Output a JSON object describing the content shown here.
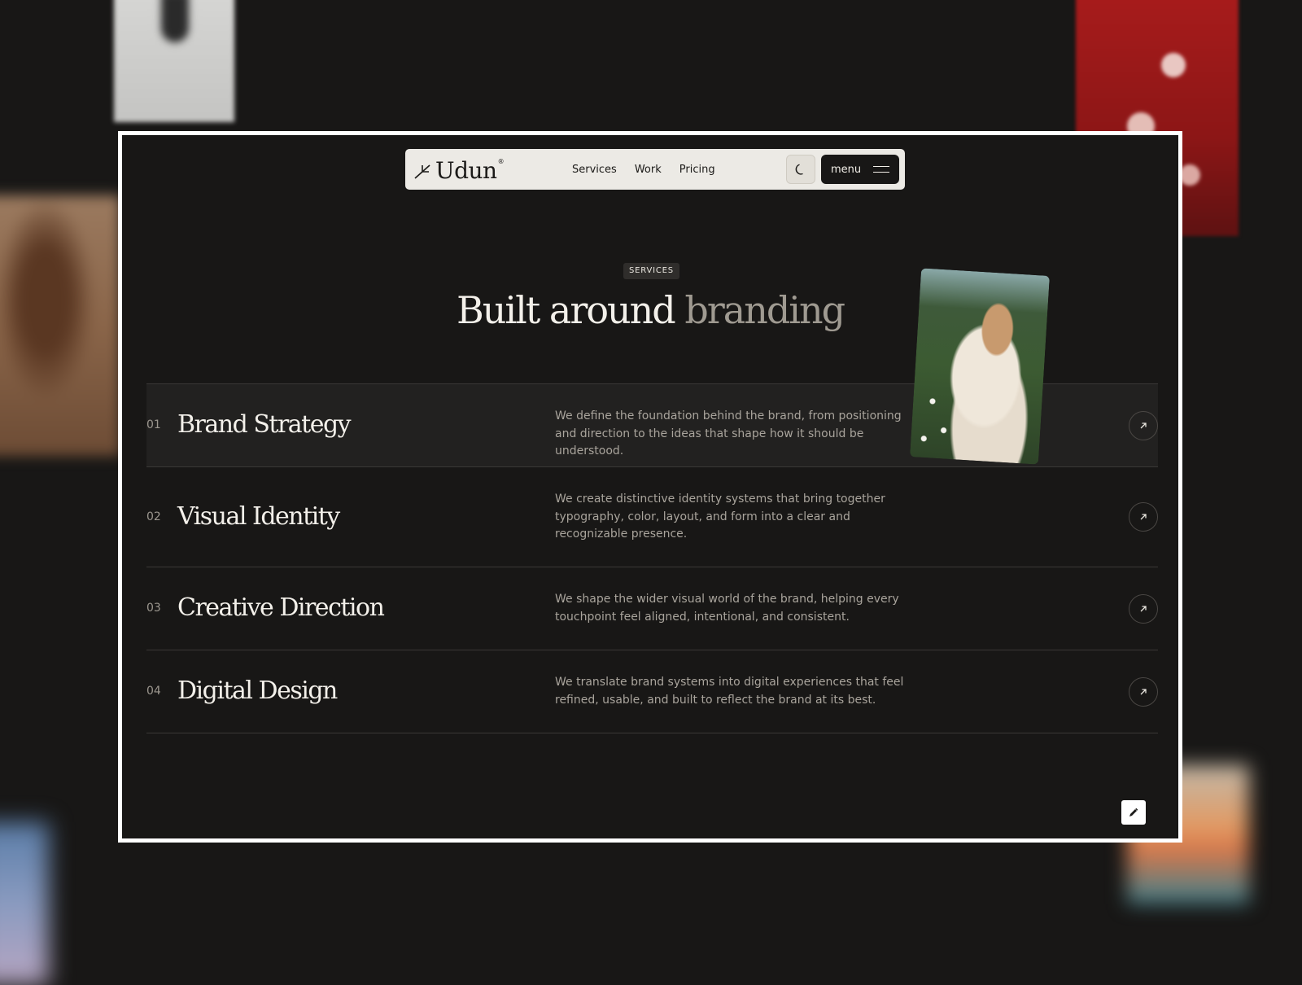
{
  "nav": {
    "brand": "Udun",
    "brand_mark": "®",
    "links": [
      "Services",
      "Work",
      "Pricing"
    ],
    "theme_icon": "moon-icon",
    "menu_label": "menu"
  },
  "hero": {
    "badge": "SERVICES",
    "title_main": "Built around",
    "title_muted": "branding"
  },
  "services": [
    {
      "num": "01",
      "name": "Brand Strategy",
      "desc": "We define the foundation behind the brand, from positioning and direction to the ideas that shape how it should be understood."
    },
    {
      "num": "02",
      "name": "Visual Identity",
      "desc": "We create distinctive identity systems that bring together typography, color, layout, and form into a clear and recognizable presence."
    },
    {
      "num": "03",
      "name": "Creative Direction",
      "desc": "We shape the wider visual world of the brand, helping every touchpoint feel aligned, intentional, and consistent."
    },
    {
      "num": "04",
      "name": "Digital Design",
      "desc": "We translate brand systems into digital experiences that feel refined, usable, and built to reflect the brand at its best."
    }
  ],
  "colors": {
    "background": "#181716",
    "nav_bg": "#eceae5",
    "text_light": "#f3f0ea",
    "text_muted": "#a9a49c",
    "frame": "#ffffff"
  }
}
